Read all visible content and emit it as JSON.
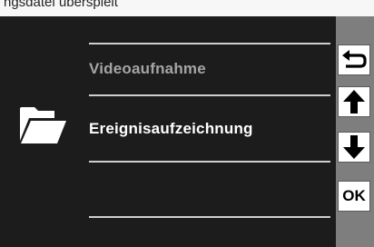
{
  "top_strip": {
    "text": "ngsdatei überspielt"
  },
  "menu": {
    "items": [
      {
        "label": "Videoaufnahme",
        "state": "inactive"
      },
      {
        "label": "Ereignisaufzeichnung",
        "state": "selected"
      }
    ],
    "selected_icon": "folder-icon"
  },
  "sidebar": {
    "buttons": [
      {
        "name": "back-icon"
      },
      {
        "name": "arrow-up-icon"
      },
      {
        "name": "arrow-down-icon"
      },
      {
        "label": "OK"
      }
    ]
  },
  "colors": {
    "screen_bg": "#1c1c1c",
    "sidebar_bg": "#7e7e7e",
    "active_text": "#ffffff",
    "inactive_text": "#a5a5a5"
  }
}
